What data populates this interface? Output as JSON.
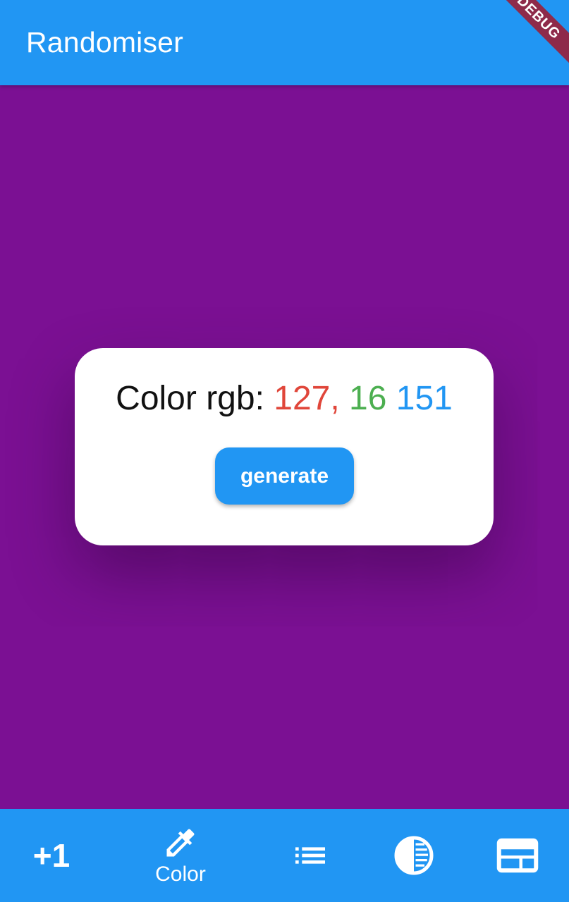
{
  "app_bar": {
    "title": "Randomiser",
    "debug_banner": "DEBUG",
    "color": "#2196F3"
  },
  "background_color": "#7B1093",
  "card": {
    "label": "Color rgb: ",
    "r": "127,",
    "g": "16",
    "b": "151",
    "generate_label": "generate"
  },
  "colors": {
    "accent": "#2196F3",
    "r_text": "#E0463A",
    "g_text": "#4CAF50",
    "b_text": "#2196F3"
  },
  "bottom_nav": {
    "items": [
      {
        "icon": "plus-one-icon",
        "label": "+1"
      },
      {
        "icon": "color-picker-icon",
        "label": "Color",
        "selected": true
      },
      {
        "icon": "list-icon",
        "label": ""
      },
      {
        "icon": "contrast-icon",
        "label": ""
      },
      {
        "icon": "panel-icon",
        "label": ""
      }
    ]
  }
}
